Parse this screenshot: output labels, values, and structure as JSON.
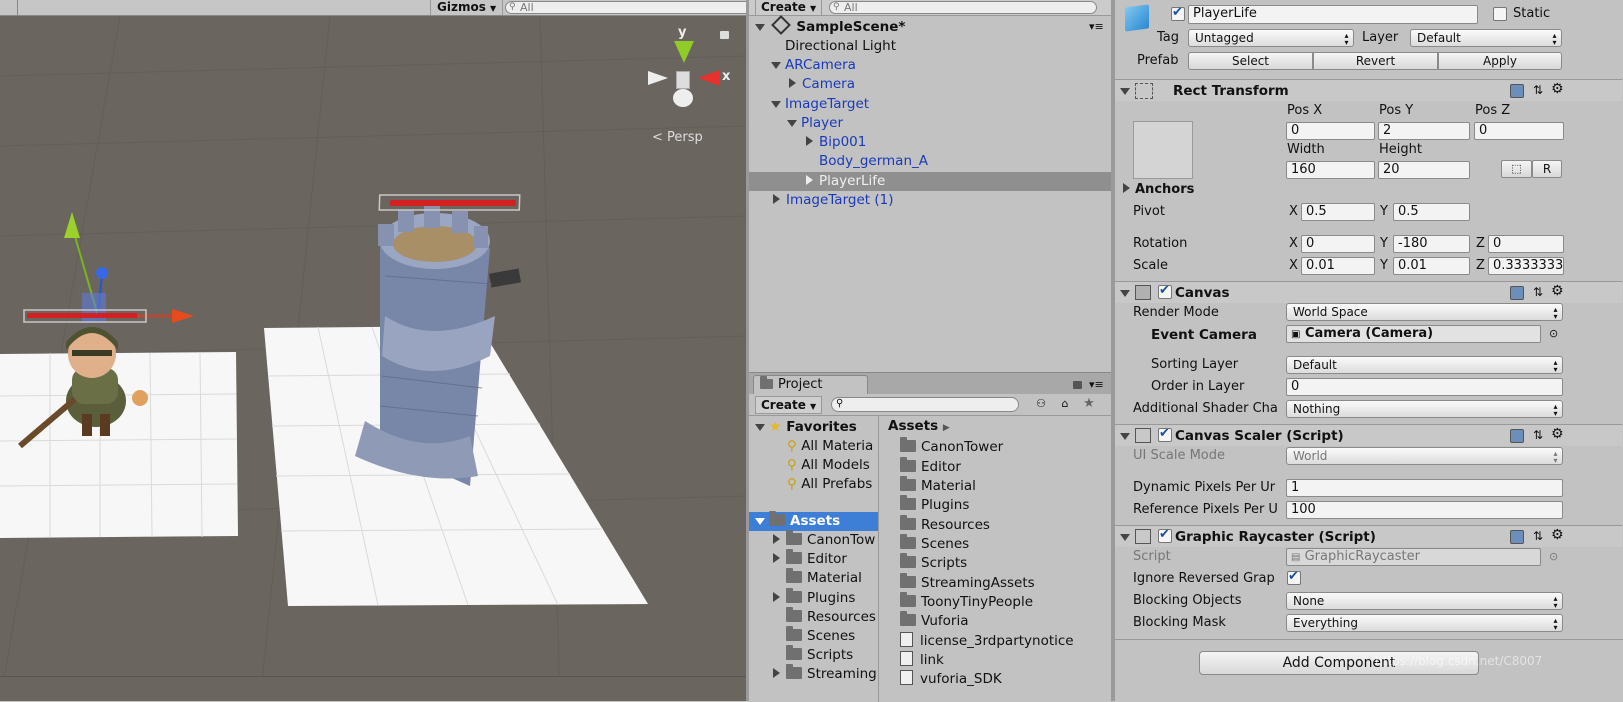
{
  "scene_view": {
    "gizmos_label": "Gizmos",
    "search_placeholder": "All",
    "persp_label": "Persp",
    "axis_y": "y",
    "axis_x": "x"
  },
  "hierarchy": {
    "create_label": "Create",
    "search_placeholder": "All",
    "scene_name": "SampleScene*",
    "items": [
      {
        "label": "Directional Light"
      },
      {
        "label": "ARCamera"
      },
      {
        "label": "Camera"
      },
      {
        "label": "ImageTarget"
      },
      {
        "label": "Player"
      },
      {
        "label": "Bip001"
      },
      {
        "label": "Body_german_A"
      },
      {
        "label": "PlayerLife"
      },
      {
        "label": "ImageTarget (1)"
      }
    ]
  },
  "project": {
    "tab_label": "Project",
    "create_label": "Create",
    "favorites_label": "Favorites",
    "favorites": [
      "All Materia",
      "All Models",
      "All Prefabs"
    ],
    "assets_label": "Assets",
    "tree": [
      "CanonTow",
      "Editor",
      "Material",
      "Plugins",
      "Resources",
      "Scenes",
      "Scripts",
      "Streaming"
    ],
    "breadcrumb": "Assets",
    "files": [
      "CanonTower",
      "Editor",
      "Material",
      "Plugins",
      "Resources",
      "Scenes",
      "Scripts",
      "StreamingAssets",
      "ToonyTinyPeople",
      "Vuforia",
      "license_3rdpartynotice",
      "link",
      "vuforia_SDK"
    ]
  },
  "inspector": {
    "object_name": "PlayerLife",
    "static_label": "Static",
    "tag_label": "Tag",
    "tag_value": "Untagged",
    "layer_label": "Layer",
    "layer_value": "Default",
    "prefab_label": "Prefab",
    "prefab_select": "Select",
    "prefab_revert": "Revert",
    "prefab_apply": "Apply",
    "rect": {
      "title": "Rect Transform",
      "posx_label": "Pos X",
      "posy_label": "Pos Y",
      "posz_label": "Pos Z",
      "posx": "0",
      "posy": "2",
      "posz": "0",
      "width_label": "Width",
      "height_label": "Height",
      "width": "160",
      "height": "20",
      "r_button": "R",
      "anchors_label": "Anchors",
      "pivot_label": "Pivot",
      "pivot_x": "0.5",
      "pivot_y": "0.5",
      "rotation_label": "Rotation",
      "rot_x": "0",
      "rot_y": "-180",
      "rot_z": "0",
      "scale_label": "Scale",
      "scale_x": "0.01",
      "scale_y": "0.01",
      "scale_z": "0.3333333",
      "x": "X",
      "y": "Y",
      "z": "Z"
    },
    "canvas": {
      "title": "Canvas",
      "render_mode_label": "Render Mode",
      "render_mode": "World Space",
      "event_camera_label": "Event Camera",
      "event_camera": "Camera (Camera)",
      "sorting_layer_label": "Sorting Layer",
      "sorting_layer": "Default",
      "order_label": "Order in Layer",
      "order": "0",
      "shader_label": "Additional Shader Cha",
      "shader": "Nothing"
    },
    "scaler": {
      "title": "Canvas Scaler (Script)",
      "ui_scale_label": "UI Scale Mode",
      "ui_scale": "World",
      "dyn_label": "Dynamic Pixels Per Ur",
      "dyn": "1",
      "ref_label": "Reference Pixels Per U",
      "ref": "100"
    },
    "raycaster": {
      "title": "Graphic Raycaster (Script)",
      "script_label": "Script",
      "script": "GraphicRaycaster",
      "ignore_label": "Ignore Reversed Grap",
      "blocking_label": "Blocking Objects",
      "blocking": "None",
      "mask_label": "Blocking Mask",
      "mask": "Everything"
    },
    "add_component": "Add Component",
    "watermark": "https://blog.csdn.net/C8007"
  },
  "colors": {
    "red_bar": "#d42020",
    "selection": "#3d7fd6",
    "scene_bg": "#6b655f"
  }
}
